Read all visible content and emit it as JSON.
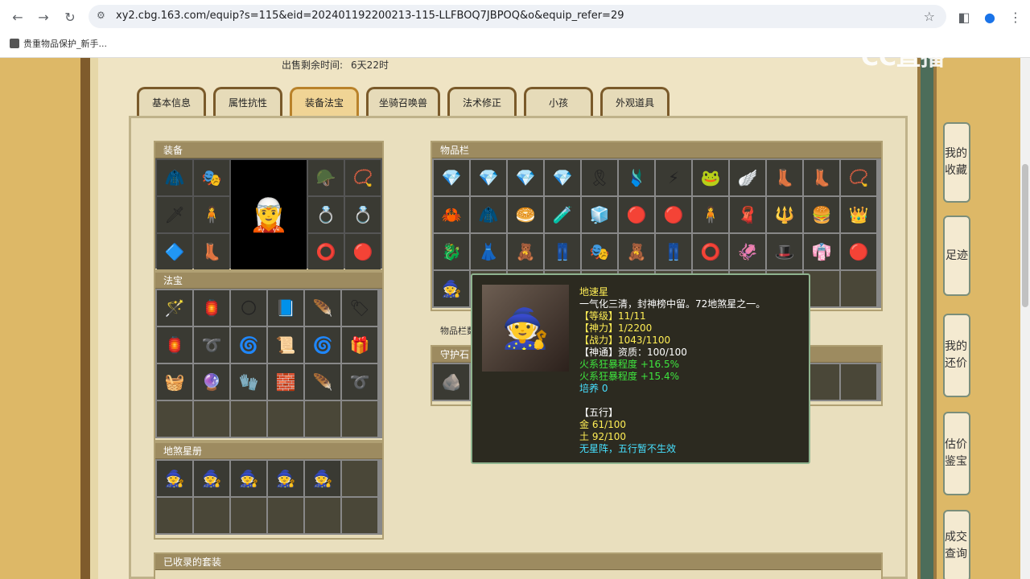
{
  "browser": {
    "url": "xy2.cbg.163.com/equip?s=115&eid=202401192200213-115-LLFBOQ7JBPOQ&o&equip_refer=29",
    "bookmark": "贵重物品保护_新手..."
  },
  "logo": "CC直播",
  "sale": {
    "label": "出售剩余时间:",
    "value": "6天22时"
  },
  "tabs": [
    "基本信息",
    "属性抗性",
    "装备法宝",
    "坐骑召唤兽",
    "法术修正",
    "小孩",
    "外观道具"
  ],
  "sections": {
    "equip": "装备",
    "fabao": "法宝",
    "disha": "地煞星册",
    "items": "物品栏",
    "guard": "守护石",
    "collected": "已收录的套装",
    "note": "物品栏数"
  },
  "side": [
    "我的收藏",
    "足迹",
    "我的还价",
    "估价鉴宝",
    "成交查询"
  ],
  "tooltip": {
    "name": "地速星",
    "desc": "一气化三清，封神榜中留。72地煞星之一。",
    "level": "【等级】11/11",
    "shenli": "【神力】1/2200",
    "zhanli": "【战力】1043/1100",
    "shentong": "【神通】资质：100/100",
    "attr1": "火系狂暴程度 +16.5%",
    "attr2": "火系狂暴程度 +15.4%",
    "peiyang": "培养 0",
    "wuxing_title": "【五行】",
    "jin": "金 61/100",
    "tu": "土 92/100",
    "star": "无星阵，五行暂不生效"
  },
  "colors": {
    "accent": "#f0d495",
    "tooltip_green": "#3ee63e",
    "tooltip_yellow": "#ffee55",
    "tooltip_cyan": "#47e0ff"
  }
}
